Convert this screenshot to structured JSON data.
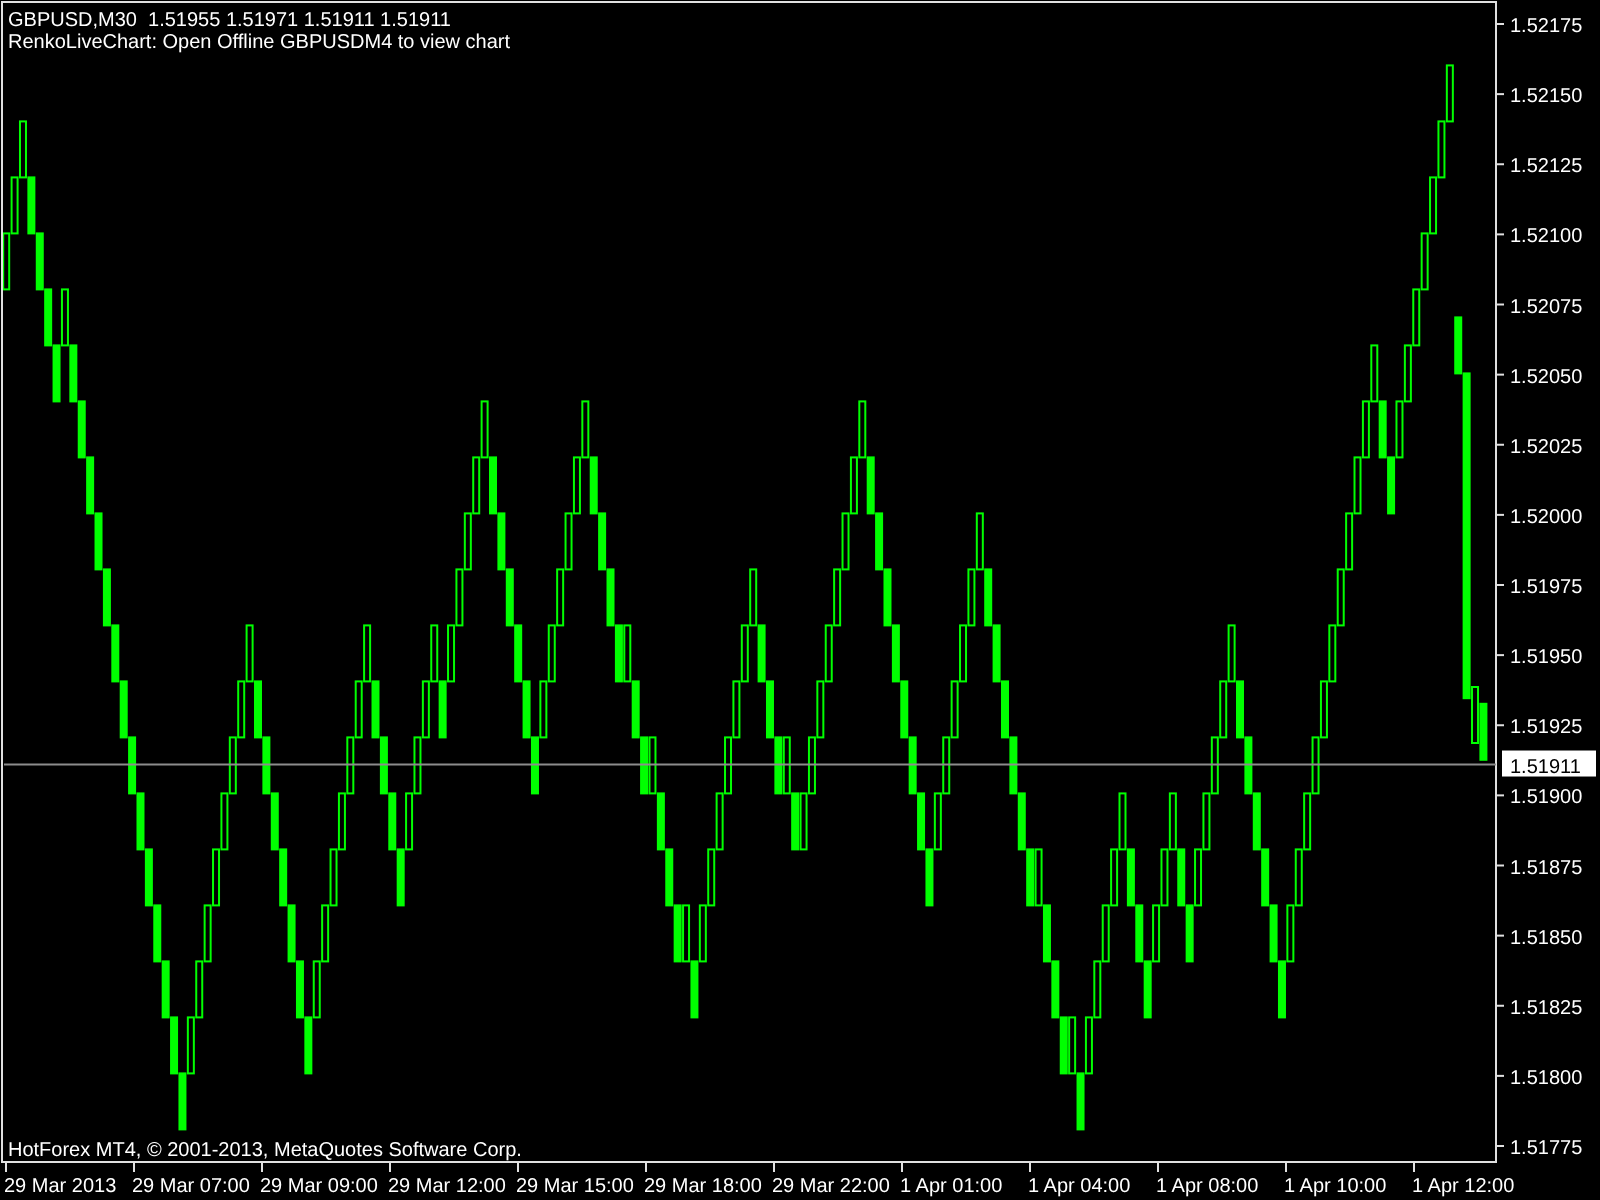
{
  "chart": {
    "header": "GBPUSD,M30  1.51955 1.51971 1.51911 1.51911",
    "comment": "RenkoLiveChart: Open Offline GBPUSDM4 to view chart",
    "footer": "HotForex MT4, © 2001-2013, MetaQuotes Software Corp.",
    "current_price": "1.51911",
    "price_labels": [
      "1.52175",
      "1.52150",
      "1.52125",
      "1.52100",
      "1.52075",
      "1.52050",
      "1.52025",
      "1.52000",
      "1.51975",
      "1.51950",
      "1.51925",
      "1.51900",
      "1.51875",
      "1.51850",
      "1.51825",
      "1.51800",
      "1.51775"
    ],
    "time_labels": [
      "29 Mar 2013",
      "29 Mar 07:00",
      "29 Mar 09:00",
      "29 Mar 12:00",
      "29 Mar 15:00",
      "29 Mar 18:00",
      "29 Mar 22:00",
      "1 Apr 01:00",
      "1 Apr 04:00",
      "1 Apr 08:00",
      "1 Apr 10:00",
      "1 Apr 12:00"
    ]
  }
}
